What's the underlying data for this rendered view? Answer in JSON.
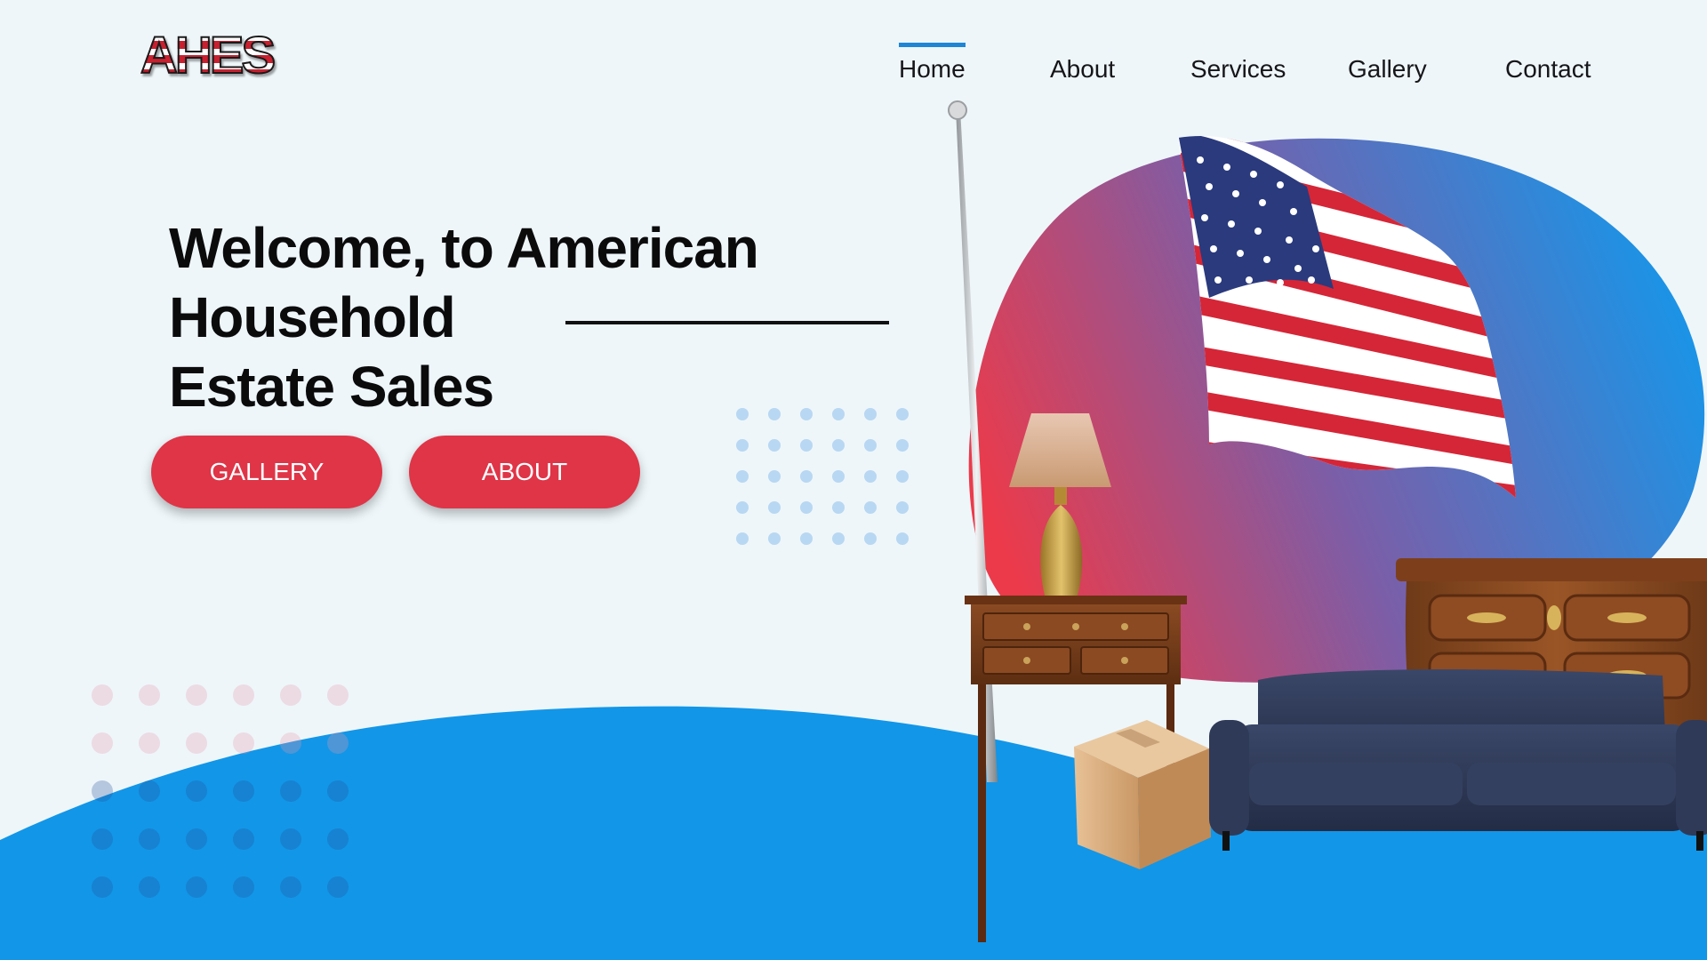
{
  "logo": {
    "text": "AHES"
  },
  "nav": {
    "items": [
      {
        "label": "Home",
        "active": true
      },
      {
        "label": "About",
        "active": false
      },
      {
        "label": "Services",
        "active": false
      },
      {
        "label": "Gallery",
        "active": false
      },
      {
        "label": "Contact",
        "active": false
      }
    ]
  },
  "hero": {
    "title_line1": "Welcome, to American Household",
    "title_line2": "Estate Sales",
    "buttons": {
      "gallery": "GALLERY",
      "about": "ABOUT"
    }
  },
  "colors": {
    "accent_red": "#df3547",
    "accent_blue": "#1f86d6",
    "wave_blue": "#1296e8",
    "background": "#eef6fa"
  },
  "illustration_icons": [
    "american-flag-icon",
    "table-lamp-icon",
    "side-table-icon",
    "cardboard-box-icon",
    "sofa-icon",
    "dresser-icon"
  ]
}
